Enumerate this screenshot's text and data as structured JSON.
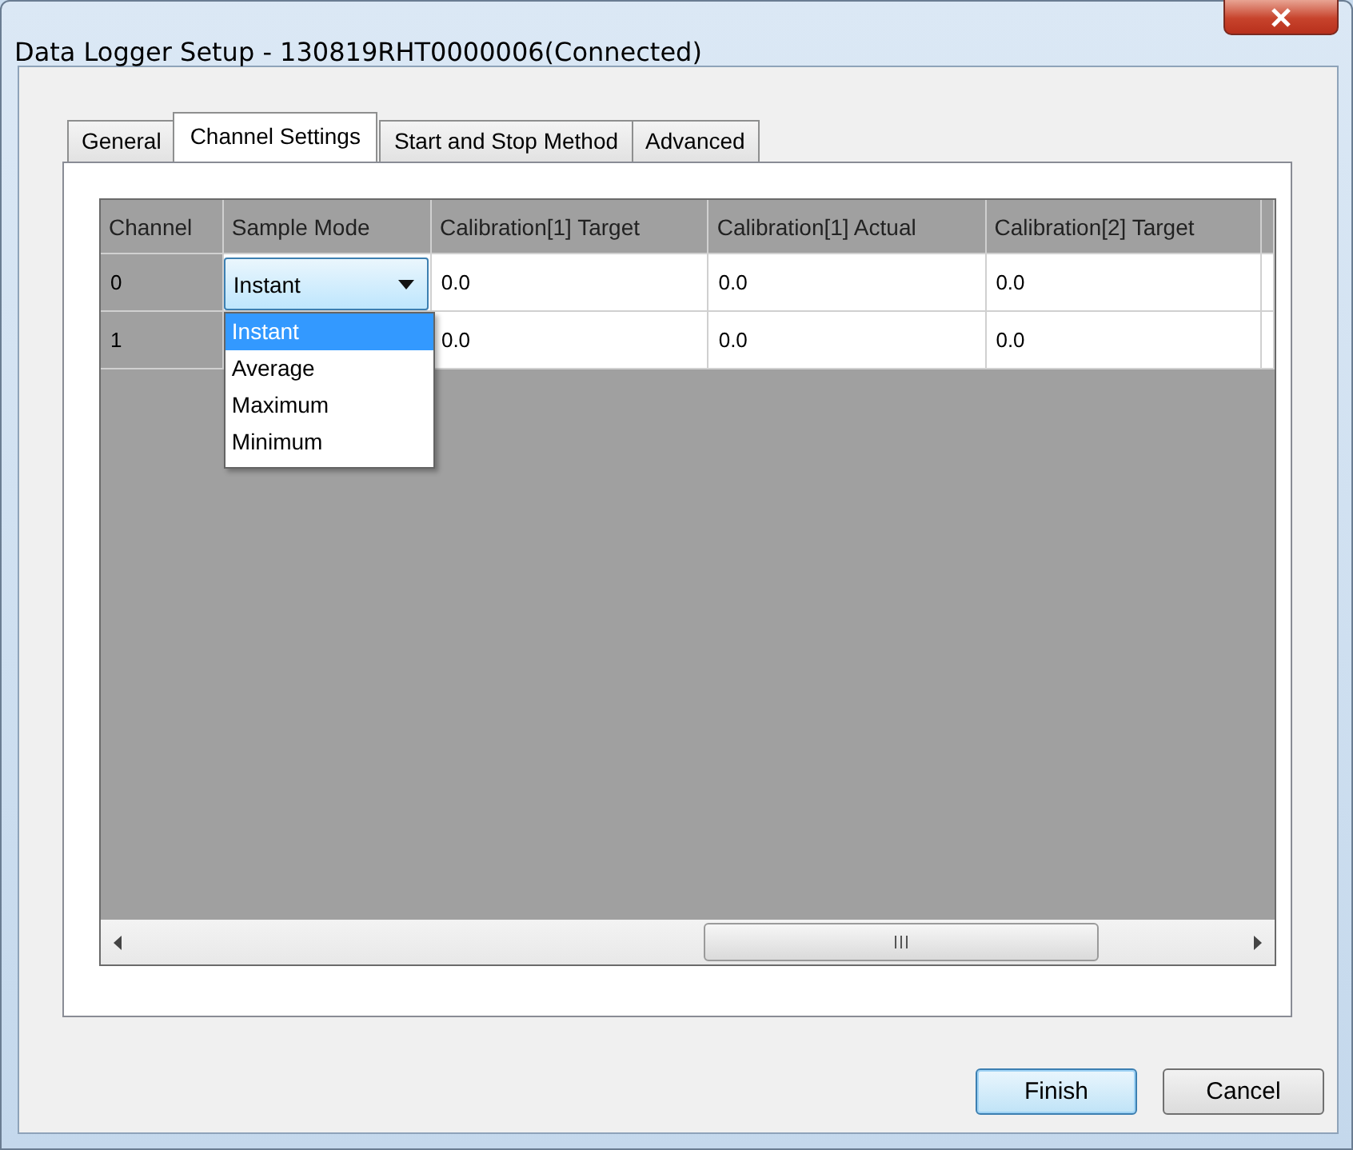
{
  "window": {
    "title": "Data Logger Setup - 130819RHT0000006(Connected)"
  },
  "tabs": [
    {
      "label": "General",
      "selected": false
    },
    {
      "label": "Channel Settings",
      "selected": true
    },
    {
      "label": "Start and Stop Method",
      "selected": false
    },
    {
      "label": "Advanced",
      "selected": false
    }
  ],
  "grid": {
    "columns": [
      "Channel",
      "Sample Mode",
      "Calibration[1] Target",
      "Calibration[1] Actual",
      "Calibration[2] Target"
    ],
    "rows": [
      {
        "cells": [
          "0",
          "Instant",
          "0.0",
          "0.0",
          "0.0"
        ],
        "dropdown_open": true
      },
      {
        "cells": [
          "1",
          "",
          "0.0",
          "0.0",
          "0.0"
        ],
        "dropdown_open": false
      }
    ],
    "dropdown_options": [
      {
        "label": "Instant",
        "selected": true
      },
      {
        "label": "Average",
        "selected": false
      },
      {
        "label": "Maximum",
        "selected": false
      },
      {
        "label": "Minimum",
        "selected": false
      }
    ]
  },
  "buttons": [
    {
      "label": "Finish",
      "default": true
    },
    {
      "label": "Cancel",
      "default": false
    }
  ]
}
